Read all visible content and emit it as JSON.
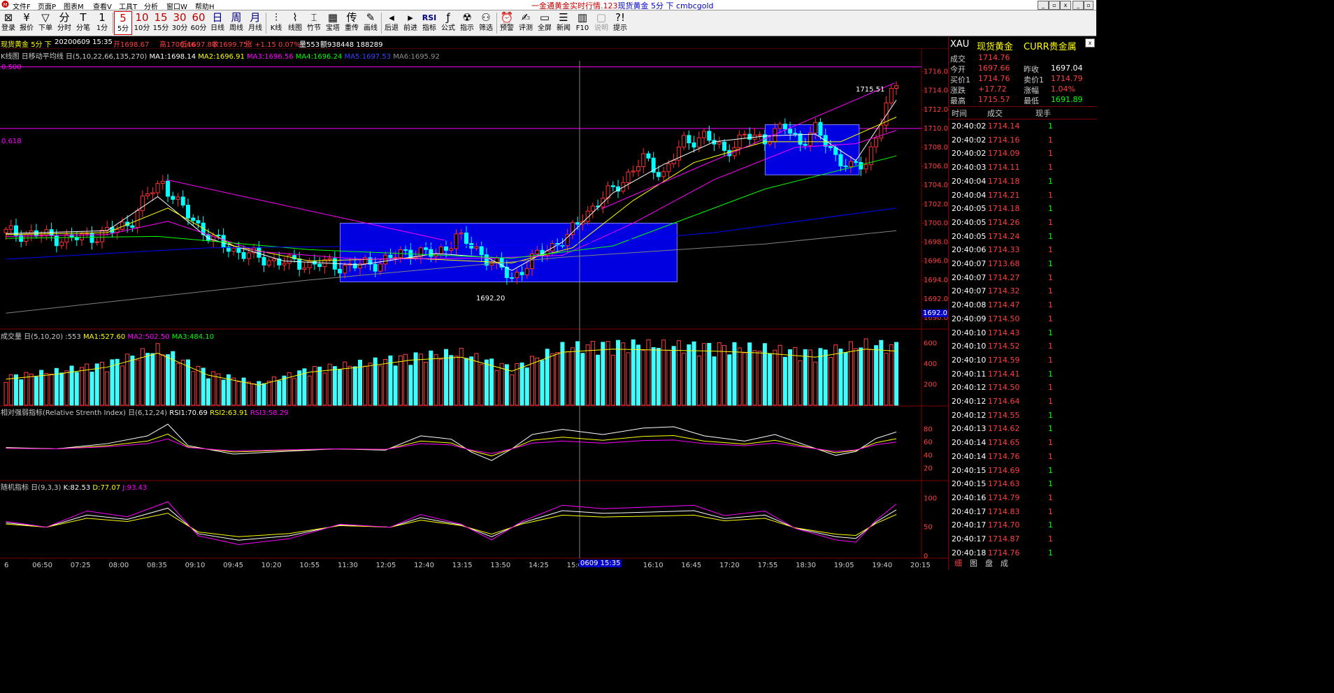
{
  "menu": {
    "items": [
      "文件F",
      "页面P",
      "图表M",
      "查看V",
      "工具T",
      "分析",
      "窗口W",
      "帮助H"
    ]
  },
  "window": {
    "title": "一金通黄金实时行情.123",
    "subtitle": "现货黄金 5分 下 cmbcgold",
    "min": "_",
    "max": "▫",
    "close": "x",
    "min2": "_",
    "restore": "▫",
    "close2": "x"
  },
  "toolbar": [
    {
      "glyph": "⊠",
      "label": "登录"
    },
    {
      "glyph": "¥",
      "label": "报价"
    },
    {
      "glyph": "▽",
      "label": "下单"
    },
    {
      "glyph": "分",
      "label": "分时"
    },
    {
      "glyph": "T",
      "label": "分笔"
    },
    {
      "glyph": "1",
      "label": "1分"
    },
    {
      "glyph": "5",
      "label": "5分"
    },
    {
      "glyph": "10",
      "label": "10分"
    },
    {
      "glyph": "15",
      "label": "15分"
    },
    {
      "glyph": "30",
      "label": "30分"
    },
    {
      "glyph": "60",
      "label": "60分"
    },
    {
      "glyph": "日",
      "label": "日线"
    },
    {
      "glyph": "周",
      "label": "周线"
    },
    {
      "glyph": "月",
      "label": "月线"
    },
    {
      "glyph": "⫶",
      "label": "K线"
    },
    {
      "glyph": "⌇",
      "label": "线图"
    },
    {
      "glyph": "⌶",
      "label": "竹节"
    },
    {
      "glyph": "▦",
      "label": "宝塔"
    },
    {
      "glyph": "传",
      "label": "重传"
    },
    {
      "glyph": "✎",
      "label": "画线"
    },
    {
      "glyph": "◂",
      "label": "后退"
    },
    {
      "glyph": "▸",
      "label": "前进"
    },
    {
      "glyph": "RSI",
      "label": "指标"
    },
    {
      "glyph": "ƒ",
      "label": "公式"
    },
    {
      "glyph": "☢",
      "label": "指示"
    },
    {
      "glyph": "⚇",
      "label": "筛选"
    },
    {
      "glyph": "⏰",
      "label": "预警"
    },
    {
      "glyph": "✍",
      "label": "评测"
    },
    {
      "glyph": "▭",
      "label": "全屏"
    },
    {
      "glyph": "☰",
      "label": "新闻"
    },
    {
      "glyph": "▥",
      "label": "F10"
    },
    {
      "glyph": "▢",
      "label": "说明"
    },
    {
      "glyph": "?!",
      "label": "提示"
    }
  ],
  "status": {
    "name": "现货黄金",
    "period": "5分",
    "dir": "下",
    "date": "20200609 15:35",
    "open": "开1698.67",
    "high": "高1700.46",
    "low": "低1697.80",
    "close": "收1699.75",
    "chg": "涨 +1.15 0.07%",
    "vol": "量553",
    "amt": "额938448 188289"
  },
  "ma_legend": {
    "title": "K线图 日移动平均线 日(5,10,22,66,135,270)",
    "ma1": "MA1:1698.14",
    "ma2": "MA2:1696.91",
    "ma3": "MA3:1696.56",
    "ma4": "MA4:1696.24",
    "ma5": "MA5:1697.53",
    "ma6": "MA6:1695.92",
    "c1": "#ffffff",
    "c2": "#ffff00",
    "c3": "#ff00ff",
    "c4": "#00ff00",
    "c5": "#0000ff",
    "c6": "#808080"
  },
  "fib": {
    "a": "0.500",
    "b": "0.618"
  },
  "price_annot": {
    "hi": "1715.51",
    "lo": "1692.20",
    "cur": "1692.0"
  },
  "vol_legend": {
    "title": "成交量 日(5,10,20) :553",
    "ma1": "MA1:527.60",
    "ma2": "MA2:502.50",
    "ma3": "MA3:484.10"
  },
  "rsi_legend": {
    "title": "相对强弱指标(Relative Strenth Index) 日(6,12,24)",
    "r1": "RSI1:70.69",
    "r2": "RSI2:63.91",
    "r3": "RSI3:58.29"
  },
  "kdj_legend": {
    "title": "随机指标 日(9,3,3)",
    "k": "K:82.53",
    "d": "D:77.07",
    "j": "J:93.43"
  },
  "price_axis": [
    "1716.0",
    "1714.0",
    "1712.0",
    "1710.0",
    "1708.0",
    "1706.0",
    "1704.0",
    "1702.0",
    "1700.0",
    "1698.0",
    "1696.0",
    "1694.0",
    "1692.0",
    "1690.0"
  ],
  "vol_axis": [
    "600",
    "400",
    "200"
  ],
  "rsi_axis": [
    "80",
    "60",
    "40",
    "20"
  ],
  "kdj_axis": [
    "100",
    "50",
    "0"
  ],
  "time_axis": [
    "6",
    "06:50",
    "07:25",
    "08:00",
    "08:35",
    "09:10",
    "09:45",
    "10:20",
    "10:55",
    "11:30",
    "12:05",
    "12:40",
    "13:15",
    "13:50",
    "14:25",
    "15:00",
    "",
    "16:10",
    "16:45",
    "17:20",
    "17:55",
    "18:30",
    "19:05",
    "19:40",
    "20:15"
  ],
  "cursor_time": "0609 15:35",
  "quote": {
    "code": "XAU",
    "name": "现货黄金",
    "market": "CURR贵金属",
    "rows": [
      {
        "l1": "成交",
        "v1": "1714.76",
        "l2": "",
        "v2": "",
        "c1": "#ff4040",
        "c2": "#ff4040"
      },
      {
        "l1": "今开",
        "v1": "1697.66",
        "l2": "昨收",
        "v2": "1697.04",
        "c1": "#ff4040",
        "c2": "#ffffff"
      },
      {
        "l1": "买价1",
        "v1": "1714.76",
        "l2": "卖价1",
        "v2": "1714.79",
        "c1": "#ff4040",
        "c2": "#ff4040"
      },
      {
        "l1": "涨跌",
        "v1": "+17.72",
        "l2": "涨幅",
        "v2": "1.04%",
        "c1": "#ff4040",
        "c2": "#ff4040"
      },
      {
        "l1": "最高",
        "v1": "1715.57",
        "l2": "最低",
        "v2": "1691.89",
        "c1": "#ff4040",
        "c2": "#00ff00"
      }
    ],
    "col_time": "时间",
    "col_price": "成交",
    "col_qty": "现手",
    "ticks": [
      {
        "t": "20:40:02",
        "p": "1714.14",
        "q": "1",
        "qc": "#00ff00"
      },
      {
        "t": "20:40:02",
        "p": "1714.16",
        "q": "1",
        "qc": "#ff4040"
      },
      {
        "t": "20:40:02",
        "p": "1714.09",
        "q": "1",
        "qc": "#ff4040"
      },
      {
        "t": "20:40:03",
        "p": "1714.11",
        "q": "1",
        "qc": "#ff4040"
      },
      {
        "t": "20:40:04",
        "p": "1714.18",
        "q": "1",
        "qc": "#00ff00"
      },
      {
        "t": "20:40:04",
        "p": "1714.21",
        "q": "1",
        "qc": "#ff4040"
      },
      {
        "t": "20:40:05",
        "p": "1714.18",
        "q": "1",
        "qc": "#00ff00"
      },
      {
        "t": "20:40:05",
        "p": "1714.26",
        "q": "1",
        "qc": "#ff4040"
      },
      {
        "t": "20:40:05",
        "p": "1714.24",
        "q": "1",
        "qc": "#00ff00"
      },
      {
        "t": "20:40:06",
        "p": "1714.33",
        "q": "1",
        "qc": "#ff4040"
      },
      {
        "t": "20:40:07",
        "p": "1713.68",
        "q": "1",
        "qc": "#00ff00"
      },
      {
        "t": "20:40:07",
        "p": "1714.27",
        "q": "1",
        "qc": "#ff4040"
      },
      {
        "t": "20:40:07",
        "p": "1714.32",
        "q": "1",
        "qc": "#ff4040"
      },
      {
        "t": "20:40:08",
        "p": "1714.47",
        "q": "1",
        "qc": "#ff4040"
      },
      {
        "t": "20:40:09",
        "p": "1714.50",
        "q": "1",
        "qc": "#ff4040"
      },
      {
        "t": "20:40:10",
        "p": "1714.43",
        "q": "1",
        "qc": "#00ff00"
      },
      {
        "t": "20:40:10",
        "p": "1714.52",
        "q": "1",
        "qc": "#ff4040"
      },
      {
        "t": "20:40:10",
        "p": "1714.59",
        "q": "1",
        "qc": "#ff4040"
      },
      {
        "t": "20:40:11",
        "p": "1714.41",
        "q": "1",
        "qc": "#00ff00"
      },
      {
        "t": "20:40:12",
        "p": "1714.50",
        "q": "1",
        "qc": "#ff4040"
      },
      {
        "t": "20:40:12",
        "p": "1714.64",
        "q": "1",
        "qc": "#ff4040"
      },
      {
        "t": "20:40:12",
        "p": "1714.55",
        "q": "1",
        "qc": "#00ff00"
      },
      {
        "t": "20:40:13",
        "p": "1714.62",
        "q": "1",
        "qc": "#00ff00"
      },
      {
        "t": "20:40:14",
        "p": "1714.65",
        "q": "1",
        "qc": "#ff4040"
      },
      {
        "t": "20:40:14",
        "p": "1714.76",
        "q": "1",
        "qc": "#ff4040"
      },
      {
        "t": "20:40:15",
        "p": "1714.69",
        "q": "1",
        "qc": "#00ff00"
      },
      {
        "t": "20:40:15",
        "p": "1714.63",
        "q": "1",
        "qc": "#00ff00"
      },
      {
        "t": "20:40:16",
        "p": "1714.79",
        "q": "1",
        "qc": "#ff4040"
      },
      {
        "t": "20:40:17",
        "p": "1714.83",
        "q": "1",
        "qc": "#ff4040"
      },
      {
        "t": "20:40:17",
        "p": "1714.70",
        "q": "1",
        "qc": "#00ff00"
      },
      {
        "t": "20:40:17",
        "p": "1714.87",
        "q": "1",
        "qc": "#ff4040"
      },
      {
        "t": "20:40:18",
        "p": "1714.76",
        "q": "1",
        "qc": "#00ff00"
      }
    ],
    "tabs": [
      "细",
      "图",
      "盘",
      "成"
    ]
  },
  "chart_data": {
    "type": "candlestick",
    "symbol": "现货黄金",
    "period": "5分",
    "ylim": [
      1690,
      1717
    ],
    "close_path": [
      [
        0,
        1699
      ],
      [
        6,
        1698.8
      ],
      [
        12,
        1698.3
      ],
      [
        17,
        1698.6
      ],
      [
        22,
        1699.3
      ],
      [
        25,
        1700.4
      ],
      [
        28,
        1703
      ],
      [
        31,
        1704.4
      ],
      [
        34,
        1702
      ],
      [
        38,
        1699.8
      ],
      [
        41,
        1698.2
      ],
      [
        45,
        1697.2
      ],
      [
        50,
        1696.3
      ],
      [
        56,
        1695.8
      ],
      [
        62,
        1695.7
      ],
      [
        68,
        1695.4
      ],
      [
        74,
        1695.9
      ],
      [
        80,
        1697.1
      ],
      [
        85,
        1696.6
      ],
      [
        89,
        1698.6
      ],
      [
        93,
        1697.2
      ],
      [
        97,
        1695.5
      ],
      [
        100,
        1694.2
      ],
      [
        103,
        1695.6
      ],
      [
        107,
        1697.4
      ],
      [
        111,
        1698.4
      ],
      [
        114,
        1700.8
      ],
      [
        118,
        1702.6
      ],
      [
        122,
        1704.6
      ],
      [
        126,
        1706.7
      ],
      [
        130,
        1705.2
      ],
      [
        134,
        1708.6
      ],
      [
        138,
        1709.2
      ],
      [
        142,
        1707.6
      ],
      [
        146,
        1709.1
      ],
      [
        150,
        1709.0
      ],
      [
        154,
        1710.1
      ],
      [
        157,
        1708.6
      ],
      [
        160,
        1709.8
      ],
      [
        164,
        1707.2
      ],
      [
        167,
        1705.7
      ],
      [
        170,
        1706.4
      ],
      [
        173,
        1710.8
      ],
      [
        176,
        1714.8
      ]
    ],
    "series": [
      {
        "name": "MA1",
        "values": [
          [
            0,
            1698.9
          ],
          [
            20,
            1699.2
          ],
          [
            30,
            1702.8
          ],
          [
            40,
            1698.4
          ],
          [
            55,
            1696.0
          ],
          [
            70,
            1695.6
          ],
          [
            85,
            1696.8
          ],
          [
            95,
            1696.4
          ],
          [
            100,
            1695.0
          ],
          [
            110,
            1698.0
          ],
          [
            120,
            1703.2
          ],
          [
            130,
            1706.2
          ],
          [
            140,
            1708.6
          ],
          [
            150,
            1709.2
          ],
          [
            160,
            1709.4
          ],
          [
            168,
            1706.6
          ],
          [
            176,
            1713.0
          ]
        ]
      },
      {
        "name": "MA2",
        "values": [
          [
            0,
            1698.8
          ],
          [
            20,
            1699.0
          ],
          [
            32,
            1701.6
          ],
          [
            45,
            1697.6
          ],
          [
            60,
            1696.0
          ],
          [
            80,
            1696.3
          ],
          [
            100,
            1695.8
          ],
          [
            112,
            1697.4
          ],
          [
            124,
            1702.4
          ],
          [
            136,
            1706.4
          ],
          [
            150,
            1708.6
          ],
          [
            165,
            1708.6
          ],
          [
            176,
            1711.2
          ]
        ]
      },
      {
        "name": "MA3",
        "values": [
          [
            0,
            1698.6
          ],
          [
            20,
            1698.8
          ],
          [
            32,
            1700.2
          ],
          [
            50,
            1697.0
          ],
          [
            70,
            1696.2
          ],
          [
            95,
            1696.3
          ],
          [
            110,
            1696.6
          ],
          [
            124,
            1700.0
          ],
          [
            140,
            1704.6
          ],
          [
            156,
            1708.0
          ],
          [
            168,
            1708.4
          ],
          [
            176,
            1709.8
          ]
        ]
      },
      {
        "name": "MA4",
        "values": [
          [
            0,
            1698.4
          ],
          [
            30,
            1698.6
          ],
          [
            60,
            1697.2
          ],
          [
            100,
            1696.3
          ],
          [
            120,
            1697.6
          ],
          [
            150,
            1703.6
          ],
          [
            176,
            1707.1
          ]
        ]
      },
      {
        "name": "MA5",
        "values": [
          [
            0,
            1696.2
          ],
          [
            40,
            1697.4
          ],
          [
            80,
            1697.6
          ],
          [
            110,
            1697.7
          ],
          [
            140,
            1699.0
          ],
          [
            176,
            1701.6
          ]
        ]
      },
      {
        "name": "MA6",
        "values": [
          [
            0,
            1690.5
          ],
          [
            60,
            1694.0
          ],
          [
            110,
            1696.4
          ],
          [
            150,
            1697.8
          ],
          [
            176,
            1699.2
          ]
        ]
      }
    ],
    "rsi": [
      [
        0,
        52
      ],
      [
        10,
        50
      ],
      [
        20,
        58
      ],
      [
        28,
        70
      ],
      [
        32,
        88
      ],
      [
        36,
        55
      ],
      [
        45,
        42
      ],
      [
        55,
        46
      ],
      [
        65,
        50
      ],
      [
        75,
        48
      ],
      [
        82,
        70
      ],
      [
        88,
        65
      ],
      [
        92,
        45
      ],
      [
        96,
        32
      ],
      [
        100,
        50
      ],
      [
        104,
        72
      ],
      [
        110,
        80
      ],
      [
        118,
        72
      ],
      [
        126,
        82
      ],
      [
        132,
        84
      ],
      [
        138,
        70
      ],
      [
        146,
        62
      ],
      [
        152,
        72
      ],
      [
        158,
        56
      ],
      [
        164,
        40
      ],
      [
        168,
        46
      ],
      [
        172,
        66
      ],
      [
        176,
        76
      ]
    ],
    "kdj": [
      [
        0,
        60
      ],
      [
        8,
        50
      ],
      [
        16,
        78
      ],
      [
        24,
        68
      ],
      [
        32,
        94
      ],
      [
        38,
        35
      ],
      [
        46,
        20
      ],
      [
        56,
        30
      ],
      [
        66,
        55
      ],
      [
        76,
        50
      ],
      [
        82,
        72
      ],
      [
        90,
        55
      ],
      [
        96,
        28
      ],
      [
        102,
        60
      ],
      [
        110,
        88
      ],
      [
        118,
        82
      ],
      [
        128,
        85
      ],
      [
        136,
        88
      ],
      [
        142,
        70
      ],
      [
        150,
        78
      ],
      [
        156,
        48
      ],
      [
        164,
        28
      ],
      [
        168,
        24
      ],
      [
        172,
        62
      ],
      [
        176,
        90
      ]
    ],
    "volume": [
      [
        0,
        260
      ],
      [
        10,
        310
      ],
      [
        20,
        380
      ],
      [
        30,
        520
      ],
      [
        40,
        300
      ],
      [
        50,
        200
      ],
      [
        60,
        330
      ],
      [
        70,
        380
      ],
      [
        80,
        450
      ],
      [
        90,
        480
      ],
      [
        100,
        340
      ],
      [
        110,
        530
      ],
      [
        120,
        560
      ],
      [
        130,
        550
      ],
      [
        140,
        540
      ],
      [
        150,
        520
      ],
      [
        160,
        480
      ],
      [
        170,
        560
      ],
      [
        176,
        540
      ]
    ],
    "boxes": [
      {
        "x0": 66,
        "x1": 133,
        "y0": 1693.8,
        "y1": 1700.0
      },
      {
        "x0": 150,
        "x1": 208,
        "y0": 1705.1,
        "y1": 1710.4
      }
    ],
    "fib_levels": [
      {
        "label": "0.500",
        "price": 1716.5
      },
      {
        "label": "0.618",
        "price": 1710.0
      }
    ],
    "annotations": [
      {
        "text": "1715.51",
        "price": 1715.51
      },
      {
        "text": "1692.20",
        "price": 1692.2
      }
    ]
  }
}
